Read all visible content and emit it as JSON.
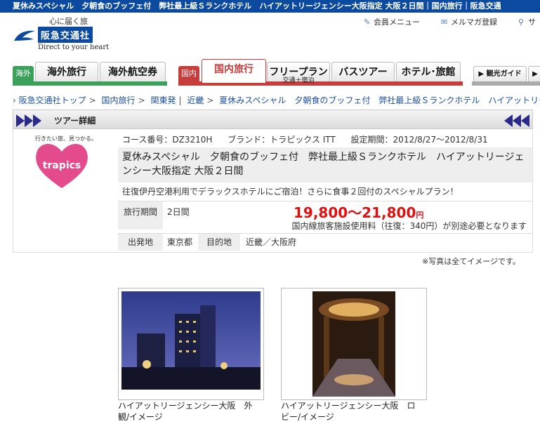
{
  "top_bar": {
    "text": "夏休みスペシャル　夕朝食のブッフェ付　弊社最上級Ｓランクホテル　ハイアットリージェンシー大阪指定 大阪２日間｜国内旅行｜阪急交通"
  },
  "logo": {
    "tagline": "心に届く旅",
    "name": "阪急交通社",
    "subtitle": "Direct to your heart"
  },
  "utility_nav": {
    "member": "会員メニュー",
    "mailmag": "メルマガ登録",
    "sitemap": "サ"
  },
  "tabs": {
    "overseas_category": "海外",
    "overseas_travel": "海外旅行",
    "overseas_air": "海外航空券",
    "domestic_category": "国内",
    "domestic_travel": "国内旅行",
    "free_plan": "フリープラン",
    "free_plan_sub": "交通＋宿泊",
    "bus_tour": "バスツアー",
    "hotel_ryokan": "ホテル･旅館",
    "kanko_guide": "観光ガイド"
  },
  "breadcrumb": {
    "home": "阪急交通社トップ",
    "domestic": "国内旅行",
    "kanto": "関東発",
    "kinki": "近畿",
    "current": "夏休みスペシャル　夕朝食のブッフェ付　弊社最上級Ｓランクホテル　ハイアットリー"
  },
  "tour": {
    "section_title": "ツアー詳細",
    "brand_tagline": "行きたい旅、見つかる。",
    "brand_logo_text": "trapics",
    "course_no": "コース番号：DZ3210H",
    "brand": "ブランド：トラピックス ITT",
    "period": "設定期間：2012/8/27〜2012/8/31",
    "title_line1": "夏休みスペシャル　夕朝食のブッフェ付　弊社最上級Ｓランクホテル　ハイアットリージェ",
    "title_line2": "ンシー大阪指定 大阪２日間",
    "description": "往復伊丹空港利用でデラックスホテルにご宿泊！さらに食事２回付のスペシャルプラン！",
    "duration_label": "旅行期間",
    "duration": "2日間",
    "price": "19,800〜21,800",
    "price_unit": "円",
    "fee_note": "国内線旅客施設使用料（往復：340円）が別途必要となります",
    "departure_label": "出発地",
    "departure": "東京都",
    "destination_label": "目的地",
    "destination": "近畿／大阪府"
  },
  "photo_note": "※写真は全てイメージです。",
  "photos": [
    {
      "caption_line1": "ハイアットリージェンシー大阪　外",
      "caption_line2": "観/イメージ"
    },
    {
      "caption_line1": "ハイアットリージェンシー大阪　ロ",
      "caption_line2": "ビー/イメージ"
    }
  ]
}
